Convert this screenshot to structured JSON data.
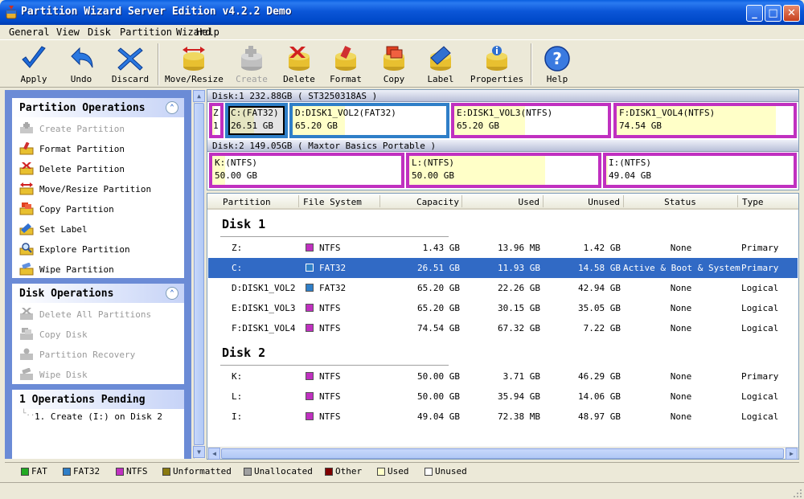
{
  "window": {
    "title": "Partition Wizard Server Edition v4.2.2 Demo"
  },
  "menu": [
    "General",
    "View",
    "Disk",
    "Partition",
    "Wizard",
    "Help"
  ],
  "toolbar": {
    "apply": "Apply",
    "undo": "Undo",
    "discard": "Discard",
    "move_resize": "Move/Resize",
    "create": "Create",
    "delete": "Delete",
    "format": "Format",
    "copy": "Copy",
    "label": "Label",
    "properties": "Properties",
    "help": "Help"
  },
  "partition_ops": {
    "title": "Partition Operations",
    "items": [
      "Create Partition",
      "Format Partition",
      "Delete Partition",
      "Move/Resize Partition",
      "Copy Partition",
      "Set Label",
      "Explore Partition",
      "Wipe Partition"
    ]
  },
  "disk_ops": {
    "title": "Disk Operations",
    "items": [
      "Delete All Partitions",
      "Copy Disk",
      "Partition Recovery",
      "Wipe Disk"
    ]
  },
  "pending": {
    "title": "1 Operations Pending",
    "items": [
      "1. Create (I:) on Disk 2"
    ]
  },
  "diskmap": {
    "disk1": {
      "header": "Disk:1 232.88GB  ( ST3250318AS )",
      "parts": [
        {
          "l1": "Z",
          "l2": "1"
        },
        {
          "l1": "C:(FAT32)",
          "l2": "26.51 GB"
        },
        {
          "l1": "D:DISK1_VOL2(FAT32)",
          "l2": "65.20 GB"
        },
        {
          "l1": "E:DISK1_VOL3(NTFS)",
          "l2": "65.20 GB"
        },
        {
          "l1": "F:DISK1_VOL4(NTFS)",
          "l2": "74.54 GB"
        }
      ]
    },
    "disk2": {
      "header": "Disk:2 149.05GB  ( Maxtor Basics Portable )",
      "parts": [
        {
          "l1": "K:(NTFS)",
          "l2": "50.00 GB"
        },
        {
          "l1": "L:(NTFS)",
          "l2": "50.00 GB"
        },
        {
          "l1": "I:(NTFS)",
          "l2": "49.04 GB"
        }
      ]
    }
  },
  "table": {
    "headers": [
      "Partition",
      "File System",
      "Capacity",
      "Used",
      "Unused",
      "Status",
      "Type"
    ],
    "disk1_label": "Disk 1",
    "disk2_label": "Disk 2",
    "disk1_rows": [
      {
        "partition": "Z:",
        "fs": "NTFS",
        "fs_color": "#c030c0",
        "capacity": "1.43 GB",
        "used": "13.96 MB",
        "unused": "1.42 GB",
        "status": "None",
        "type": "Primary"
      },
      {
        "partition": "C:",
        "fs": "FAT32",
        "fs_color": "#2f7fc8",
        "capacity": "26.51 GB",
        "used": "11.93 GB",
        "unused": "14.58 GB",
        "status": "Active & Boot & System",
        "type": "Primary",
        "selected": true
      },
      {
        "partition": "D:DISK1_VOL2",
        "fs": "FAT32",
        "fs_color": "#2f7fc8",
        "capacity": "65.20 GB",
        "used": "22.26 GB",
        "unused": "42.94 GB",
        "status": "None",
        "type": "Logical"
      },
      {
        "partition": "E:DISK1_VOL3",
        "fs": "NTFS",
        "fs_color": "#c030c0",
        "capacity": "65.20 GB",
        "used": "30.15 GB",
        "unused": "35.05 GB",
        "status": "None",
        "type": "Logical"
      },
      {
        "partition": "F:DISK1_VOL4",
        "fs": "NTFS",
        "fs_color": "#c030c0",
        "capacity": "74.54 GB",
        "used": "67.32 GB",
        "unused": "7.22 GB",
        "status": "None",
        "type": "Logical"
      }
    ],
    "disk2_rows": [
      {
        "partition": "K:",
        "fs": "NTFS",
        "fs_color": "#c030c0",
        "capacity": "50.00 GB",
        "used": "3.71 GB",
        "unused": "46.29 GB",
        "status": "None",
        "type": "Primary"
      },
      {
        "partition": "L:",
        "fs": "NTFS",
        "fs_color": "#c030c0",
        "capacity": "50.00 GB",
        "used": "35.94 GB",
        "unused": "14.06 GB",
        "status": "None",
        "type": "Logical"
      },
      {
        "partition": "I:",
        "fs": "NTFS",
        "fs_color": "#c030c0",
        "capacity": "49.04 GB",
        "used": "72.38 MB",
        "unused": "48.97 GB",
        "status": "None",
        "type": "Logical"
      }
    ]
  },
  "legend": [
    {
      "label": "FAT",
      "color": "#22aa22"
    },
    {
      "label": "FAT32",
      "color": "#2f7fc8"
    },
    {
      "label": "NTFS",
      "color": "#c030c0"
    },
    {
      "label": "Unformatted",
      "color": "#8a7a10"
    },
    {
      "label": "Unallocated",
      "color": "#a0a0a0"
    },
    {
      "label": "Other",
      "color": "#800000"
    },
    {
      "label": "Used",
      "color": "#ffffc8"
    },
    {
      "label": "Unused",
      "color": "#ffffff"
    }
  ]
}
